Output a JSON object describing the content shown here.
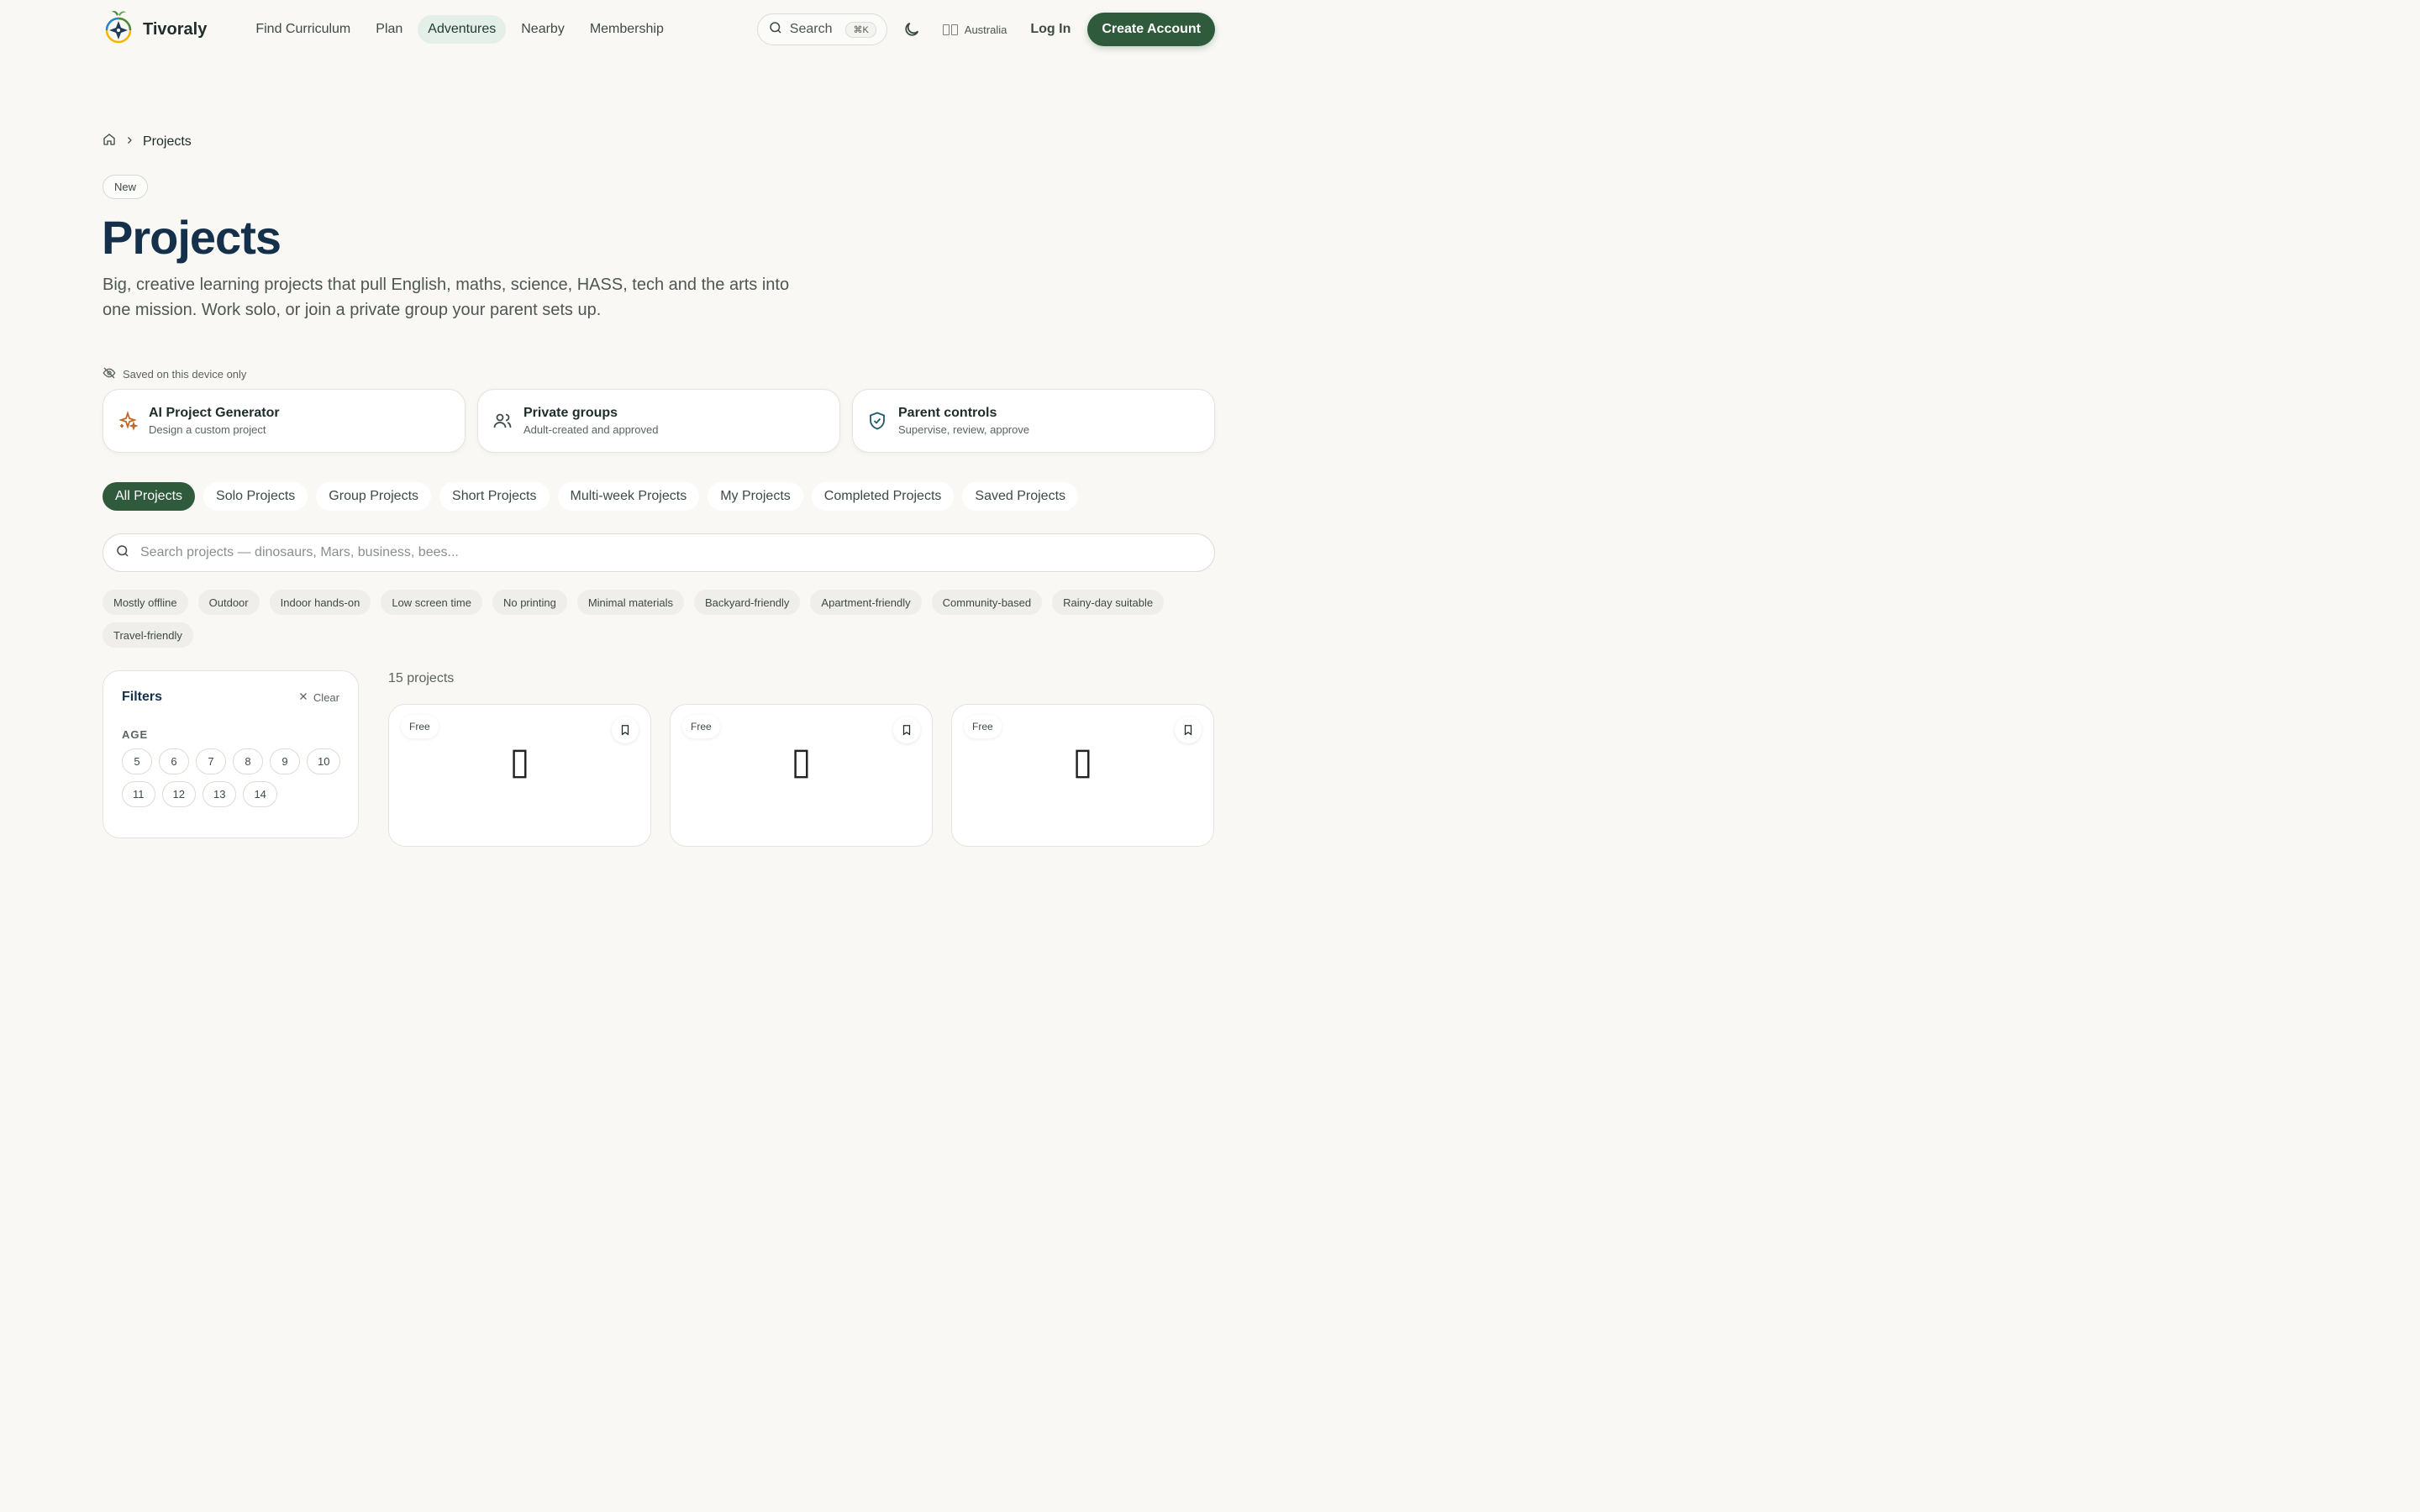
{
  "header": {
    "brand": "Tivoraly",
    "nav": [
      {
        "label": "Find Curriculum",
        "active": false
      },
      {
        "label": "Plan",
        "active": false
      },
      {
        "label": "Adventures",
        "active": true
      },
      {
        "label": "Nearby",
        "active": false
      },
      {
        "label": "Membership",
        "active": false
      }
    ],
    "search_label": "Search",
    "search_shortcut": "⌘K",
    "region": "Australia",
    "login": "Log In",
    "create_account": "Create Account"
  },
  "breadcrumb": {
    "current": "Projects"
  },
  "badge": "New",
  "page": {
    "title": "Projects",
    "description": "Big, creative learning projects that pull English, maths, science, HASS, tech and the arts into one mission. Work solo, or join a private group your parent sets up."
  },
  "saved_note": "Saved on this device only",
  "features": [
    {
      "icon": "sparkle-icon",
      "title": "AI Project Generator",
      "subtitle": "Design a custom project"
    },
    {
      "icon": "users-icon",
      "title": "Private groups",
      "subtitle": "Adult-created and approved"
    },
    {
      "icon": "shield-check-icon",
      "title": "Parent controls",
      "subtitle": "Supervise, review, approve"
    }
  ],
  "tabs": [
    {
      "label": "All Projects",
      "active": true
    },
    {
      "label": "Solo Projects"
    },
    {
      "label": "Group Projects"
    },
    {
      "label": "Short Projects"
    },
    {
      "label": "Multi-week Projects"
    },
    {
      "label": "My Projects"
    },
    {
      "label": "Completed Projects"
    },
    {
      "label": "Saved Projects"
    }
  ],
  "project_search": {
    "placeholder": "Search projects — dinosaurs, Mars, business, bees...",
    "value": ""
  },
  "chips": [
    "Mostly offline",
    "Outdoor",
    "Indoor hands-on",
    "Low screen time",
    "No printing",
    "Minimal materials",
    "Backyard-friendly",
    "Apartment-friendly",
    "Community-based",
    "Rainy-day suitable",
    "Travel-friendly"
  ],
  "filters": {
    "title": "Filters",
    "clear": "Clear",
    "age_label": "AGE",
    "ages": [
      "5",
      "6",
      "7",
      "8",
      "9",
      "10",
      "11",
      "12",
      "13",
      "14"
    ]
  },
  "results": {
    "count": "15 projects",
    "cards": [
      {
        "tag": "Free",
        "emoji": "▯"
      },
      {
        "tag": "Free",
        "emoji": "▯"
      },
      {
        "tag": "Free",
        "emoji": "▯"
      }
    ]
  },
  "colors": {
    "accent": "#2f5a3c",
    "title": "#14304a",
    "active_nav_bg": "#e3efe8",
    "background": "#f9f8f5"
  }
}
